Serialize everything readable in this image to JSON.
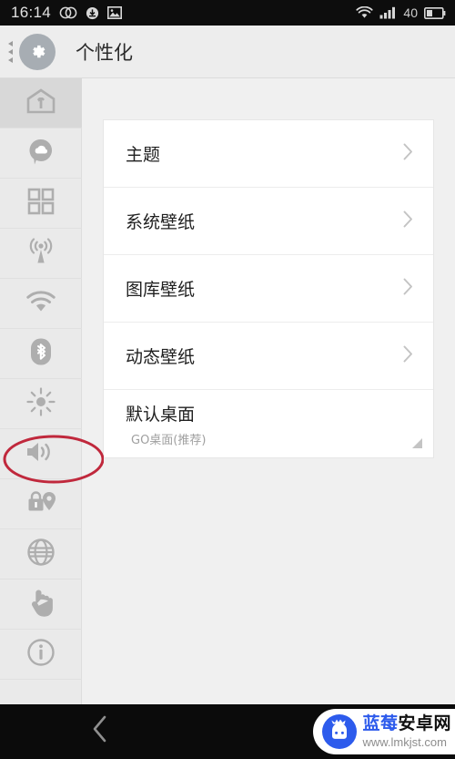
{
  "status_bar": {
    "time": "16:14",
    "battery_percent": "40",
    "left_icons": [
      "dual-circles-icon",
      "download-sync-icon",
      "image-icon"
    ],
    "right_icons": [
      "wifi-icon",
      "signal-bars-icon",
      "battery-icon"
    ]
  },
  "title_bar": {
    "title": "个性化",
    "app_icon": "gear-icon",
    "drag_handle": "drag-handle-icon"
  },
  "sidebar": {
    "items": [
      {
        "icon": "home-personalization-icon",
        "name": "sidebar-item-personalization",
        "active": true
      },
      {
        "icon": "cloud-chat-icon",
        "name": "sidebar-item-cloud",
        "active": false
      },
      {
        "icon": "apps-grid-icon",
        "name": "sidebar-item-apps",
        "active": false
      },
      {
        "icon": "broadcast-antenna-icon",
        "name": "sidebar-item-network",
        "active": false
      },
      {
        "icon": "wifi-icon",
        "name": "sidebar-item-wifi",
        "active": false
      },
      {
        "icon": "bluetooth-icon",
        "name": "sidebar-item-bluetooth",
        "active": false
      },
      {
        "icon": "brightness-sun-icon",
        "name": "sidebar-item-display",
        "active": false
      },
      {
        "icon": "volume-speaker-icon",
        "name": "sidebar-item-sound",
        "active": false
      },
      {
        "icon": "lock-location-icon",
        "name": "sidebar-item-privacy",
        "active": false
      },
      {
        "icon": "globe-icon",
        "name": "sidebar-item-language",
        "active": false
      },
      {
        "icon": "touch-hand-icon",
        "name": "sidebar-item-gestures",
        "active": false
      },
      {
        "icon": "info-circle-icon",
        "name": "sidebar-item-about",
        "active": false
      }
    ]
  },
  "main": {
    "rows": [
      {
        "label": "主题",
        "sub": "",
        "accessory": "chevron"
      },
      {
        "label": "系统壁纸",
        "sub": "",
        "accessory": "chevron"
      },
      {
        "label": "图库壁纸",
        "sub": "",
        "accessory": "chevron"
      },
      {
        "label": "动态壁纸",
        "sub": "",
        "accessory": "chevron"
      },
      {
        "label": "默认桌面",
        "sub": "GO桌面(推荐)",
        "accessory": "corner-triangle"
      }
    ]
  },
  "annotation": {
    "shape": "ellipse",
    "color": "#c0283c",
    "targets": "sidebar-item-sound"
  },
  "nav_bar": {
    "back_icon": "back-chevron-icon"
  },
  "watermark": {
    "logo": "blueberry-android-logo",
    "brand_blue": "蓝莓",
    "brand_black": "安卓网",
    "url": "www.lmkjst.com",
    "accent_color": "#2d5bec"
  }
}
